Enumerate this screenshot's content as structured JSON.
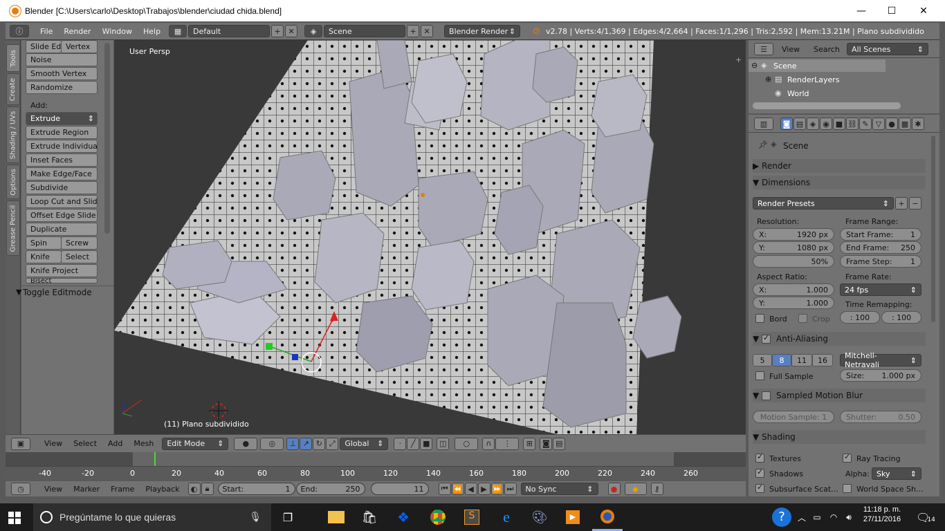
{
  "window": {
    "title": "Blender [C:\\Users\\carlo\\Desktop\\Trabajos\\blender\\ciudad chida.blend]",
    "minimize": "—",
    "maximize": "☐",
    "close": "✕"
  },
  "info_header": {
    "menus": [
      "File",
      "Render",
      "Window",
      "Help"
    ],
    "screen_layout": "Default",
    "scene": "Scene",
    "engine": "Blender Render",
    "stats": "v2.78 | Verts:4/1,369 | Edges:4/2,664 | Faces:1/1,296 | Tris:2,592 | Mem:13.21M | Plano subdividido"
  },
  "tool_tabs": [
    "Tools",
    "Create",
    "Shading / UVs",
    "Options",
    "Grease Pencil"
  ],
  "toolshelf": {
    "row1": [
      "Slide Ed",
      "Vertex"
    ],
    "noise": "Noise",
    "smooth_vertex": "Smooth Vertex",
    "randomize": "Randomize",
    "add_label": "Add:",
    "extrude": "Extrude",
    "items": [
      "Extrude Region",
      "Extrude Individual",
      "Inset Faces",
      "Make Edge/Face",
      "Subdivide",
      "Loop Cut and Slide",
      "Offset Edge Slide",
      "Duplicate"
    ],
    "spin": "Spin",
    "screw": "Screw",
    "knife": "Knife",
    "select": "Select",
    "knife_project": "Knife Project",
    "bisect": "Bisect",
    "toggle_editmode": "Toggle Editmode"
  },
  "viewport": {
    "view_label": "User Persp",
    "object_label": "(11) Plano subdividido"
  },
  "view3d_header": {
    "menus": [
      "View",
      "Select",
      "Add",
      "Mesh"
    ],
    "mode": "Edit Mode",
    "orientation": "Global"
  },
  "timeline": {
    "ruler": [
      "-40",
      "-20",
      "0",
      "20",
      "40",
      "60",
      "80",
      "100",
      "120",
      "140",
      "160",
      "180",
      "200",
      "220",
      "240",
      "260"
    ],
    "menus": [
      "View",
      "Marker",
      "Frame",
      "Playback"
    ],
    "start_label": "Start:",
    "start": "1",
    "end_label": "End:",
    "end": "250",
    "current": "11",
    "sync": "No Sync"
  },
  "outliner": {
    "menus": [
      "View",
      "Search"
    ],
    "filter": "All Scenes",
    "scene": "Scene",
    "render_layers": "RenderLayers",
    "world": "World"
  },
  "properties": {
    "context": "Scene",
    "render_panel": "Render",
    "dimensions_panel": "Dimensions",
    "render_presets": "Render Presets",
    "resolution_label": "Resolution:",
    "res_x_label": "X:",
    "res_x": "1920 px",
    "res_y_label": "Y:",
    "res_y": "1080 px",
    "res_pct": "50%",
    "frame_range_label": "Frame Range:",
    "start_frame_label": "Start Frame:",
    "start_frame": "1",
    "end_frame_label": "End Frame:",
    "end_frame": "250",
    "frame_step_label": "Frame Step:",
    "frame_step": "1",
    "aspect_label": "Aspect Ratio:",
    "asp_x_label": "X:",
    "asp_x": "1.000",
    "asp_y_label": "Y:",
    "asp_y": "1.000",
    "frame_rate_label": "Frame Rate:",
    "frame_rate": "24 fps",
    "time_remap_label": "Time Remapping:",
    "remap_old": ": 100",
    "remap_new": ": 100",
    "bord": "Bord",
    "crop": "Crop",
    "aa_panel": "Anti-Aliasing",
    "aa_samples": [
      "5",
      "8",
      "11",
      "16"
    ],
    "aa_filter": "Mitchell-Netravali",
    "full_sample": "Full Sample",
    "size_label": "Size:",
    "size": "1.000 px",
    "motion_blur_panel": "Sampled Motion Blur",
    "motion_sample": "Motion Sample: 1",
    "shutter_label": "Shutter:",
    "shutter": "0.50",
    "shading_panel": "Shading",
    "textures": "Textures",
    "ray_tracing": "Ray Tracing",
    "shadows": "Shadows",
    "alpha_label": "Alpha:",
    "alpha": "Sky",
    "subsurface": "Subsurface Scat...",
    "world_space": "World Space Sh..."
  },
  "taskbar": {
    "search_placeholder": "Pregúntame lo que quieras",
    "time": "11:18 p. m.",
    "date": "27/11/2016",
    "notifications": "14"
  },
  "colors": {
    "blender_orange": "#e87d0d",
    "selected_blue": "#5680c2",
    "taskbar": "#1c1c1c"
  }
}
